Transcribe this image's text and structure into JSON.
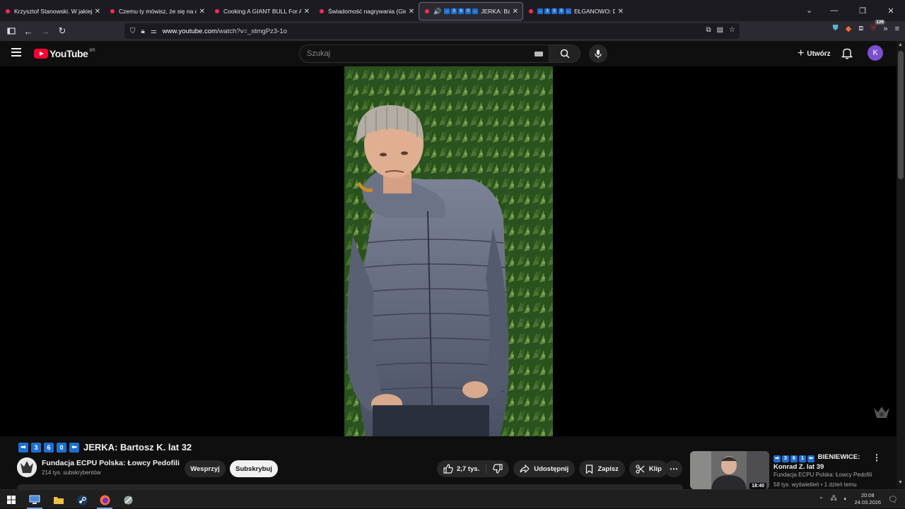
{
  "browser": {
    "tabs": [
      {
        "title": "Krzysztof Stanowski. W jakiej sy",
        "active": false
      },
      {
        "title": "Czemu ty mówisz, że się na ciebi",
        "active": false
      },
      {
        "title": "Cooking A GIANT BULL For A G",
        "active": false
      },
      {
        "title": "Świadomość nagrywania (Giełd",
        "active": false
      },
      {
        "title": "JERKA: Barto",
        "active": true,
        "badges": [
          "→",
          "3",
          "6",
          "0",
          "←"
        ]
      },
      {
        "title": "EŁGANOWO: D",
        "active": false,
        "badges": [
          "→",
          "3",
          "5",
          "5",
          "←"
        ]
      }
    ],
    "url_host": "www.youtube.com",
    "url_path": "/watch?v=_stmgPz3-1o",
    "extension_badge": "126",
    "colors": {
      "tabstrip": "#1c1b22",
      "toolbar": "#2b2a33",
      "favicon": "#ff2a55"
    }
  },
  "youtube": {
    "logo_text": "YouTube",
    "country_code": "BR",
    "search_placeholder": "Szukaj",
    "create_label": "Utwórz",
    "avatar_letter": "K",
    "colors": {
      "background": "#0f0f0f",
      "brand": "#ff0033",
      "avatar": "#7b4fd2",
      "badge": "#1e6fd1"
    }
  },
  "video": {
    "badges": [
      "➡",
      "3",
      "6",
      "0",
      "⬅"
    ],
    "title_text": "JERKA: Bartosz K. lat 32",
    "channel_name": "Fundacja ECPU Polska: Łowcy Pedofili",
    "subscribers": "214 tys. subskrybentów",
    "support_label": "Wesprzyj",
    "subscribe_label": "Subskrybuj",
    "likes": "2,7 tys.",
    "share_label": "Udostępnij",
    "save_label": "Zapisz",
    "clip_label": "Klip"
  },
  "related": {
    "badges": [
      "➡",
      "3",
      "6",
      "1",
      "⬅"
    ],
    "title_line1": "BIENIEWICE:",
    "title_line2": "Konrad Z. lat 39",
    "channel": "Fundacja ECPU Polska: Łowcy Pedofili",
    "meta": "58 tys. wyświetleń • 1 dzień temu",
    "duration": "18:40"
  },
  "taskbar": {
    "time": "20:08",
    "date": "24.03.2026"
  }
}
